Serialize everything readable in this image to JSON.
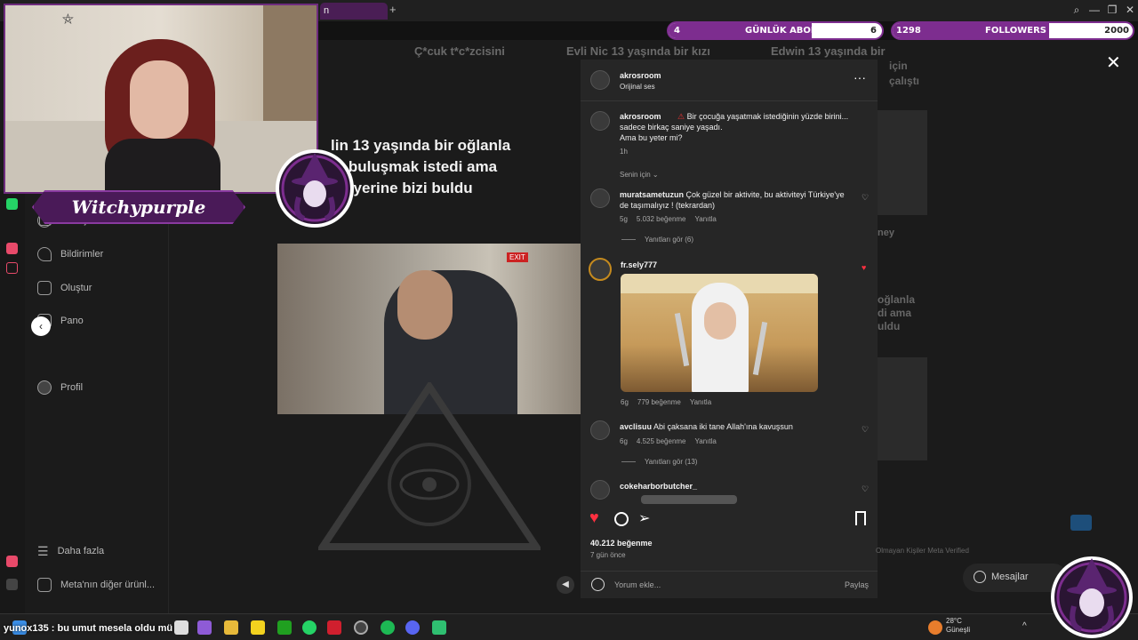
{
  "browser": {
    "tab_label": "n",
    "new_tab": "+"
  },
  "overlay": {
    "subs": {
      "label": "GÜNLÜK ABONE",
      "current": "4",
      "goal": "6",
      "progress": 0.67
    },
    "followers": {
      "label": "FOLLOWERS",
      "current": "1298",
      "goal": "2000",
      "progress": 0.65
    }
  },
  "streamer": {
    "name": "Witchypurple"
  },
  "sidebar": {
    "items": [
      {
        "label": "Mesajlar",
        "icon": "messenger-icon"
      },
      {
        "label": "Bildirimler",
        "icon": "heart-icon"
      },
      {
        "label": "Oluştur",
        "icon": "plus-square-icon"
      },
      {
        "label": "Pano",
        "icon": "dashboard-icon"
      },
      {
        "label": "Profil",
        "icon": "profile-icon"
      }
    ],
    "more": "Daha fazla",
    "meta_products": "Meta'nın diğer ürünl..."
  },
  "background": {
    "titles": [
      "Ç*cuk t*c*zcisini",
      "Evli Nic 13 yaşında bir kızı",
      "Edwin 13 yaşında bir"
    ],
    "right_snippets": [
      "için",
      "çalıştı",
      "ney",
      "oğlanla",
      "di ama",
      "uldu"
    ],
    "reel_caption": [
      "lin 13 yaşında bir oğlanla",
      "in buluşmak istedi ama",
      "un yerine bizi buldu"
    ],
    "exit_sign": "EXIT",
    "messages_button": "Mesajlar",
    "footer": "Olmayan Kişiler    Meta Verified"
  },
  "modal": {
    "author": {
      "username": "akrosroom",
      "audio": "Orijinal ses"
    },
    "caption": {
      "username": "akrosroom",
      "text_line1": "Bir çocuğa yaşatmak istediğinin yüzde birini...",
      "text_line2": "sadece birkaç saniye yaşadı.",
      "text_line3": "Ama bu yeter mi?",
      "time": "1h"
    },
    "filter": "Senin için",
    "comments": [
      {
        "username": "muratsametuzun",
        "text_line1": "Çok güzel bir aktivite, bu aktiviteyi Türkiye'ye",
        "text_line2": "de taşımalıyız ! (tekrardan)",
        "time": "5g",
        "likes": "5.032 beğenme",
        "reply": "Yanıtla",
        "view_replies": "Yanıtları gör (6)",
        "liked": false
      },
      {
        "username": "fr.sely777",
        "time": "6g",
        "likes": "779 beğenme",
        "reply": "Yanıtla",
        "liked": true
      },
      {
        "username": "avclisuu",
        "text_line1": "Abi çaksana iki tane Allah'ına kavuşsun",
        "time": "6g",
        "likes": "4.525 beğenme",
        "reply": "Yanıtla",
        "view_replies": "Yanıtları gör (13)",
        "liked": false
      },
      {
        "username": "cokeharborbutcher_",
        "liked": false
      }
    ],
    "likes_count": "40.212 beğenme",
    "posted": "7 gün önce",
    "comment_placeholder": "Yorum ekle...",
    "share": "Paylaş"
  },
  "taskbar": {
    "chat_message": "yunox135 : bu umut mesela oldu mü",
    "weather_temp": "28°C",
    "weather_desc": "Güneşli"
  },
  "colors": {
    "accent_purple": "#7d2d8f",
    "like_red": "#ff3040",
    "modal_bg": "#262626"
  }
}
